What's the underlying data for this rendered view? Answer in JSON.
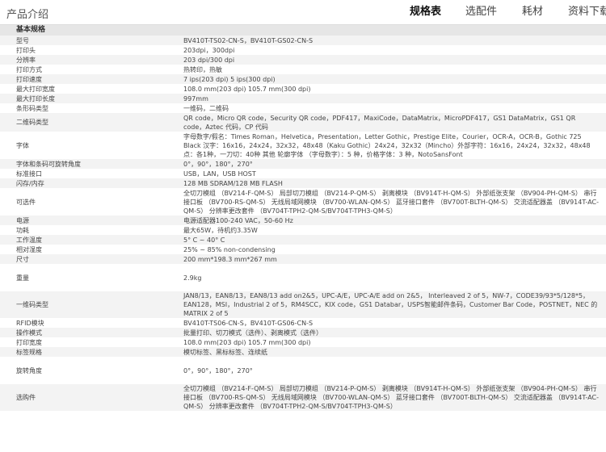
{
  "header": {
    "brand": "产品介绍",
    "tabs": [
      {
        "label": "规格表",
        "active": true
      },
      {
        "label": "选配件",
        "active": false
      },
      {
        "label": "耗材",
        "active": false
      },
      {
        "label": "资料下载",
        "active": false
      }
    ]
  },
  "section": {
    "title": "基本规格"
  },
  "rows": [
    {
      "label": "型号",
      "value": "BV410T-TS02-CN-S，BV410T-GS02-CN-S"
    },
    {
      "label": "打印头",
      "value": "203dpi，300dpi"
    },
    {
      "label": "分辨率",
      "value": "203 dpi/300 dpi"
    },
    {
      "label": "打印方式",
      "value": "热转印，热敏"
    },
    {
      "label": "打印速度",
      "value": "7 ips(203 dpi) 5 ips(300 dpi)"
    },
    {
      "label": "最大打印宽度",
      "value": "108.0 mm(203 dpi) 105.7 mm(300 dpi)"
    },
    {
      "label": "最大打印长度",
      "value": "997mm"
    },
    {
      "label": "条形码类型",
      "value": "一维码，二维码"
    },
    {
      "label": "二维码类型",
      "value": "QR code，Micro QR code，Security QR code，PDF417，MaxiCode，DataMatrix，MicroPDF417，GS1 DataMatrix，GS1 QR code，Aztec 代码，CP 代码"
    },
    {
      "label": "字体",
      "value": "字母数字/假名：Times Roman，Helvetica，Presentation，Letter Gothic，Prestige Elite，Courier，OCR-A，OCR-B，Gothic 725 Black 汉字：16x16，24x24，32x32，48x48（Kaku Gothic）24x24，32x32（Mincho）外部字符：16x16，24x24，32x32，48x48点：各1种，一刀切：40种 其他 轮廓字体 （字母数字）：5 种，价格字体：3 种，NotoSansFont"
    },
    {
      "label": "字体和条码可旋转角度",
      "value": "0°，90°，180°，270°"
    },
    {
      "label": "标准接口",
      "value": "USB，LAN，USB HOST"
    },
    {
      "label": "闪存/内存",
      "value": "128 MB SDRAM/128 MB FLASH"
    },
    {
      "label": "可选件",
      "value": "全切刀模组 （BV214-F-QM-S） 局部切刀模组 （BV214-P-QM-S） 剥离模块 （BV914T-H-QM-S） 外部纸张支架 （BV904-PH-QM-S） 串行接口板 （BV700-RS-QM-S） 无线局域网模块 （BV700-WLAN-QM-S） 蓝牙接口套件 （BV700T-BLTH-QM-S） 交流适配器盖 （BV914T-AC-QM-S） 分辨率更改套件 （BV704T-TPH2-QM-S/BV704T-TPH3-QM-S）"
    },
    {
      "label": "电源",
      "value": "电源适配器100-240 VAC，50-60 Hz"
    },
    {
      "label": "功耗",
      "value": "最大65W，待机约3.35W"
    },
    {
      "label": "工作温度",
      "value": "5° C ~ 40° C"
    },
    {
      "label": "相对湿度",
      "value": "25% ~ 85% non-condensing"
    },
    {
      "label": "尺寸",
      "value": "200 mm*198.3 mm*267 mm"
    },
    {
      "label": "重量",
      "value": "2.9kg"
    },
    {
      "label": "一维码类型",
      "value": "JAN8/13，EAN8/13，EAN8/13 add on2&5，UPC-A/E，UPC-A/E add on 2&5， Interleaved 2 of 5，NW-7，CODE39/93*5/128*5，EAN128，MSI，Industrial 2 of 5，RM4SCC，KIX code，GS1 Databar，USPS智能邮件条码，Customer Bar Code，POSTNET，NEC 的 MATRIX 2 of 5"
    },
    {
      "label": "RFID模块",
      "value": "BV410T-TS06-CN-S，BV410T-GS06-CN-S"
    },
    {
      "label": "操作模式",
      "value": "批量打印、切刀模式（选件）、剥离模式（选件）"
    },
    {
      "label": "打印宽度",
      "value": "108.0 mm(203 dpi) 105.7 mm(300 dpi)"
    },
    {
      "label": "标签规格",
      "value": "模切标签、黑标标签、连续纸"
    },
    {
      "label": "旋转角度",
      "value": "0°，90°，180°，270°"
    },
    {
      "label": "选购件",
      "value": "全切刀模组 （BV214-F-QM-S） 局部切刀模组 （BV214-P-QM-S） 剥离模块 （BV914T-H-QM-S） 外部纸张支架 （BV904-PH-QM-S） 串行接口板 （BV700-RS-QM-S） 无线局域网模块 （BV700-WLAN-QM-S） 蓝牙接口套件 （BV700T-BLTH-QM-S） 交流适配器盖 （BV914T-AC-QM-S） 分辨率更改套件 （BV704T-TPH2-QM-S/BV704T-TPH3-QM-S）"
    }
  ]
}
